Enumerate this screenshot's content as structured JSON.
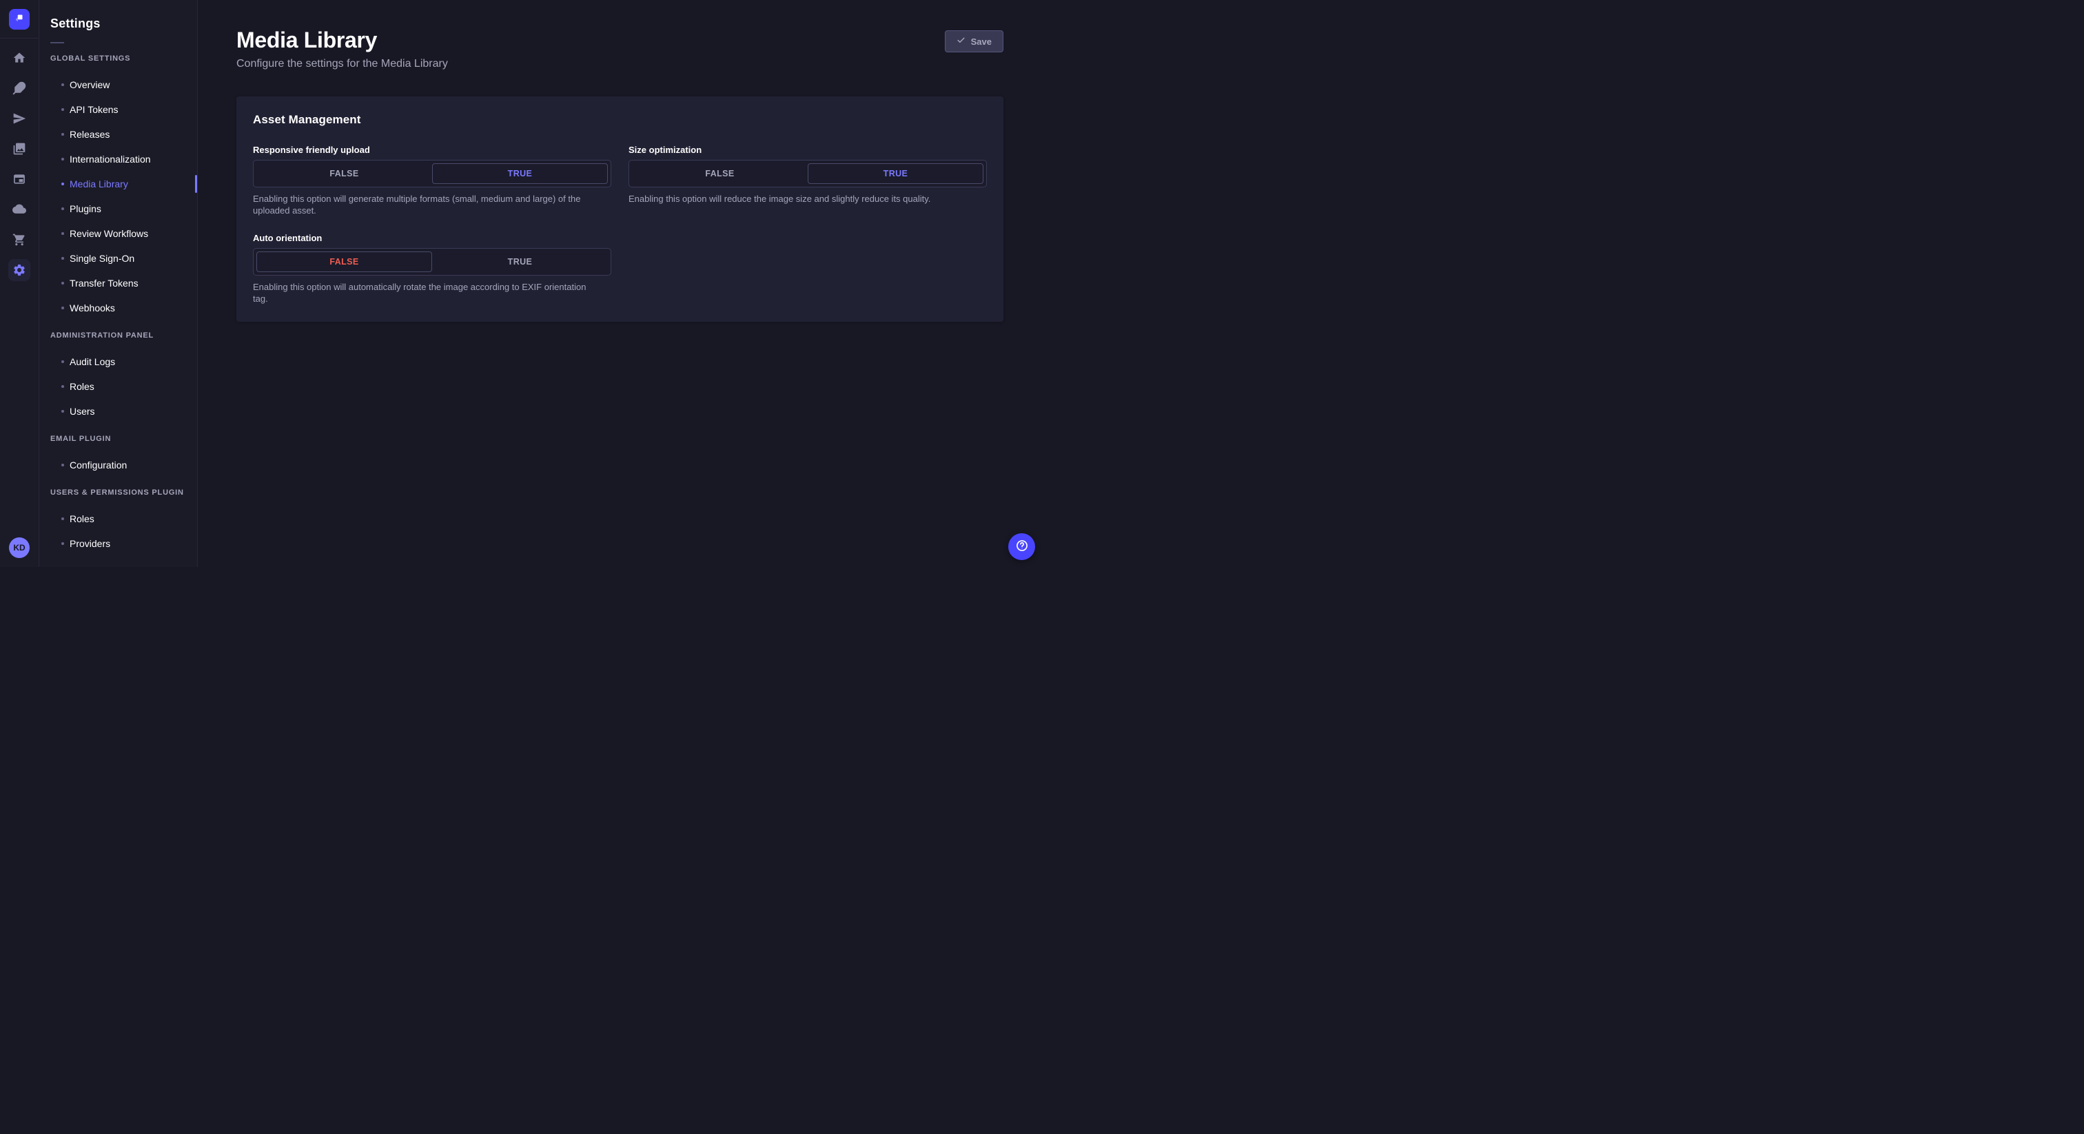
{
  "colors": {
    "accent": "#7b79ff",
    "primary": "#4945ff",
    "danger": "#ee5e52",
    "page_bg": "#181825",
    "panel_bg": "#1b1b28",
    "card_bg": "#212134",
    "muted": "#a5a5ba"
  },
  "iconbar": {
    "logo_icon": "strapi-logo-icon",
    "items": [
      {
        "icon": "home-icon"
      },
      {
        "icon": "feather-icon"
      },
      {
        "icon": "paper-plane-icon"
      },
      {
        "icon": "media-library-icon"
      },
      {
        "icon": "content-window-icon"
      },
      {
        "icon": "cloud-icon"
      },
      {
        "icon": "cart-icon"
      },
      {
        "icon": "gear-icon",
        "active": true
      }
    ],
    "avatar_initials": "KD"
  },
  "subnav": {
    "title": "Settings",
    "sections": [
      {
        "label": "GLOBAL SETTINGS",
        "items": [
          {
            "label": "Overview"
          },
          {
            "label": "API Tokens"
          },
          {
            "label": "Releases"
          },
          {
            "label": "Internationalization"
          },
          {
            "label": "Media Library",
            "active": true
          },
          {
            "label": "Plugins"
          },
          {
            "label": "Review Workflows"
          },
          {
            "label": "Single Sign-On"
          },
          {
            "label": "Transfer Tokens"
          },
          {
            "label": "Webhooks"
          }
        ]
      },
      {
        "label": "ADMINISTRATION PANEL",
        "items": [
          {
            "label": "Audit Logs"
          },
          {
            "label": "Roles"
          },
          {
            "label": "Users"
          }
        ]
      },
      {
        "label": "EMAIL PLUGIN",
        "items": [
          {
            "label": "Configuration"
          }
        ]
      },
      {
        "label": "USERS & PERMISSIONS PLUGIN",
        "items": [
          {
            "label": "Roles"
          },
          {
            "label": "Providers"
          }
        ]
      }
    ]
  },
  "header": {
    "title": "Media Library",
    "subtitle": "Configure the settings for the Media Library",
    "save_label": "Save"
  },
  "card": {
    "title": "Asset Management",
    "fields": [
      {
        "label": "Responsive friendly upload",
        "options": [
          "FALSE",
          "TRUE"
        ],
        "selected": "TRUE",
        "selected_color": "#7b79ff",
        "hint": "Enabling this option will generate multiple formats (small, medium and large) of the uploaded asset."
      },
      {
        "label": "Size optimization",
        "options": [
          "FALSE",
          "TRUE"
        ],
        "selected": "TRUE",
        "selected_color": "#7b79ff",
        "hint": "Enabling this option will reduce the image size and slightly reduce its quality."
      },
      {
        "label": "Auto orientation",
        "options": [
          "FALSE",
          "TRUE"
        ],
        "selected": "FALSE",
        "selected_color": "#ee5e52",
        "hint": "Enabling this option will automatically rotate the image according to EXIF orientation tag."
      }
    ]
  },
  "help": {
    "icon": "question-icon"
  }
}
